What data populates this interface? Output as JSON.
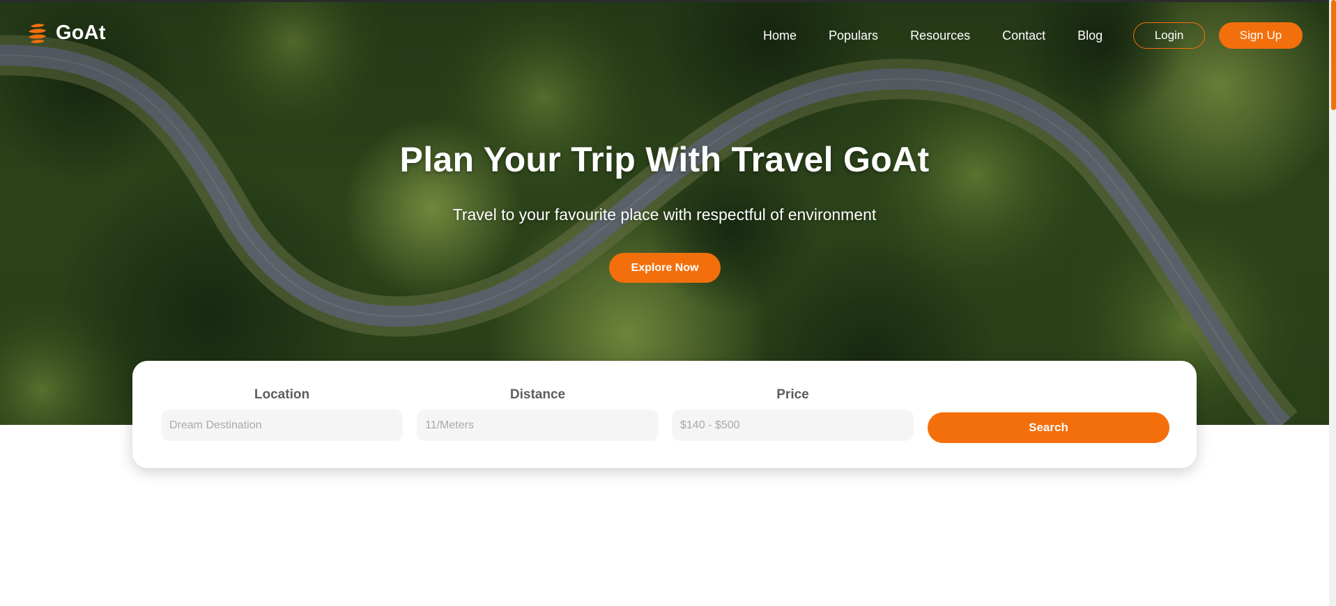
{
  "brand": {
    "name": "GoAt",
    "accent": "#f36f0c",
    "logo_icon": "stacked-globe-icon"
  },
  "nav": {
    "items": [
      {
        "label": "Home"
      },
      {
        "label": "Populars"
      },
      {
        "label": "Resources"
      },
      {
        "label": "Contact"
      },
      {
        "label": "Blog"
      }
    ],
    "login_label": "Login",
    "signup_label": "Sign Up"
  },
  "hero": {
    "title": "Plan Your Trip With Travel GoAt",
    "subtitle": "Travel to your favourite place with respectful of environment",
    "cta_label": "Explore Now",
    "background": "aerial-forest-road-image"
  },
  "search": {
    "location": {
      "label": "Location",
      "placeholder": "Dream Destination"
    },
    "distance": {
      "label": "Distance",
      "placeholder": "11/Meters"
    },
    "price": {
      "label": "Price",
      "placeholder": "$140 - $500"
    },
    "button_label": "Search"
  }
}
